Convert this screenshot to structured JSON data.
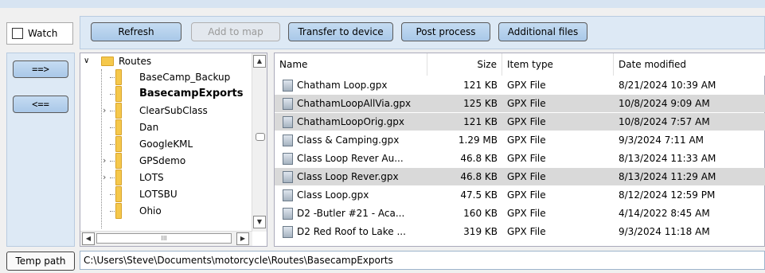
{
  "toolbar": {
    "watch_label": "Watch",
    "refresh_label": "Refresh",
    "add_to_map_label": "Add to map",
    "transfer_label": "Transfer to device",
    "post_process_label": "Post process",
    "additional_files_label": "Additional files"
  },
  "side": {
    "send_right_label": "==>",
    "send_left_label": "<=="
  },
  "tree": {
    "root_label": "Routes",
    "items": [
      {
        "label": "BaseCamp_Backup",
        "expandable": false,
        "bold": false
      },
      {
        "label": "BasecampExports",
        "expandable": false,
        "bold": true
      },
      {
        "label": "ClearSubClass",
        "expandable": true,
        "bold": false
      },
      {
        "label": "Dan",
        "expandable": false,
        "bold": false
      },
      {
        "label": "GoogleKML",
        "expandable": false,
        "bold": false
      },
      {
        "label": "GPSdemo",
        "expandable": true,
        "bold": false
      },
      {
        "label": "LOTS",
        "expandable": true,
        "bold": false
      },
      {
        "label": "LOTSBU",
        "expandable": false,
        "bold": false
      },
      {
        "label": "Ohio",
        "expandable": false,
        "bold": false
      }
    ],
    "hscroll_thumb_glyph": "III"
  },
  "list": {
    "columns": [
      "Name",
      "Size",
      "Item type",
      "Date modified"
    ],
    "rows": [
      {
        "name": "Chatham Loop.gpx",
        "size": "121 KB",
        "type": "GPX File",
        "date": "8/21/2024 10:39 AM",
        "selected": false
      },
      {
        "name": "ChathamLoopAllVia.gpx",
        "size": "125 KB",
        "type": "GPX File",
        "date": "10/8/2024 9:09 AM",
        "selected": true
      },
      {
        "name": "ChathamLoopOrig.gpx",
        "size": "121 KB",
        "type": "GPX File",
        "date": "10/8/2024 7:57 AM",
        "selected": true
      },
      {
        "name": "Class & Camping.gpx",
        "size": "1.29 MB",
        "type": "GPX File",
        "date": "9/3/2024 7:11 AM",
        "selected": false
      },
      {
        "name": "Class Loop Rever Au...",
        "size": "46.8 KB",
        "type": "GPX File",
        "date": "8/13/2024 11:33 AM",
        "selected": false
      },
      {
        "name": "Class Loop Rever.gpx",
        "size": "46.8 KB",
        "type": "GPX File",
        "date": "8/13/2024 11:29 AM",
        "selected": true
      },
      {
        "name": "Class Loop.gpx",
        "size": "47.5 KB",
        "type": "GPX File",
        "date": "8/12/2024 12:59 PM",
        "selected": false
      },
      {
        "name": "D2 -Butler #21 - Aca...",
        "size": "160 KB",
        "type": "GPX File",
        "date": "4/14/2022 8:45 AM",
        "selected": false
      },
      {
        "name": "D2 Red Roof to Lake ...",
        "size": "319 KB",
        "type": "GPX File",
        "date": "9/3/2024 11:18 AM",
        "selected": false
      }
    ]
  },
  "bottom": {
    "temp_path_label": "Temp path",
    "path_value": "C:\\Users\\Steve\\Documents\\motorcycle\\Routes\\BasecampExports"
  },
  "colors": {
    "panel_bg": "#dde9f5",
    "button_bg": "#b8d3ee",
    "selected_row": "#d9d9d9",
    "folder": "#f5c84c"
  }
}
